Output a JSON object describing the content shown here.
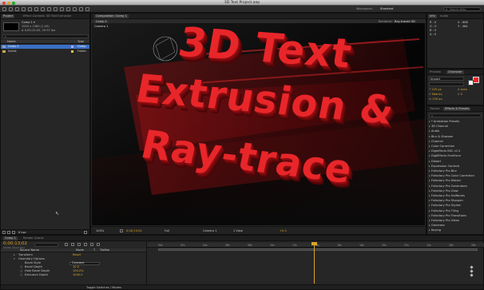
{
  "window": {
    "title": "3D Text Project.aep"
  },
  "toolbar": {
    "search_placeholder": "Search Help",
    "workspace": "Standard"
  },
  "project": {
    "tabs": [
      "Project",
      "Effect Controls: 3D Text Extrusion"
    ],
    "comp_name": "Comp 1 ▾",
    "comp_info": [
      "1920 x 1080 (1.00)",
      "Δ 0;00;10;00, 29.97 fps"
    ],
    "col_name": "Name",
    "col_type": "Type",
    "items": [
      {
        "name": "Comp 1",
        "type": "Comp"
      },
      {
        "name": "Solids",
        "type": "Folder"
      }
    ],
    "footer_bpc": "8 bpc"
  },
  "composition": {
    "tab": "Composition: Comp 1",
    "subtab": "Comp 1",
    "renderer_label": "Renderer:",
    "renderer_value": "Ray-traced 3D",
    "camera_label": "Camera 1",
    "text_lines": [
      "3D Text",
      "Extrusion &",
      "Ray-trace"
    ],
    "footer": {
      "zoom": "100%",
      "timecode": "0;00;13;02",
      "res": "Full",
      "camera": "Camera 1",
      "view": "1 View",
      "exposure": "+0.0"
    }
  },
  "info": {
    "tabs": [
      "Info",
      "Audio"
    ],
    "lines": [
      {
        "k": "R :",
        "v": "0"
      },
      {
        "k": "G :",
        "v": "0"
      },
      {
        "k": "B :",
        "v": "0"
      },
      {
        "k": "A :",
        "v": "0"
      }
    ],
    "x": "X : 668",
    "y": "Y : 464"
  },
  "character": {
    "tabs": [
      "Preview",
      "Character"
    ],
    "font": "Impact",
    "size": "225 px",
    "leading": "Auto",
    "kerning": "Metrics",
    "tracking": "0",
    "stroke": "150 px"
  },
  "effects": {
    "tabs": [
      "Tracker",
      "Effects & Presets"
    ],
    "items": [
      "* Animation Presets",
      "3D Channel",
      "Audio",
      "Blur & Sharpen",
      "Channel",
      "Color Correction",
      "Digieffects BSC v1.5",
      "DigiEffects FreeForm",
      "Distort",
      "Expression Controls",
      "Fxfactory Pro Blur",
      "Fxfactory Pro Color Correction",
      "Fxfactory Pro Distort",
      "Fxfactory Pro Generators",
      "Fxfactory Pro Glow",
      "Fxfactory Pro Halftones",
      "Fxfactory Pro Sharpen",
      "Fxfactory Pro Stylize",
      "Fxfactory Pro Tiling",
      "Fxfactory Pro Transitions",
      "Fxfactory Pro Video",
      "Generate",
      "Keying"
    ]
  },
  "timeline": {
    "tabs": [
      "Comp 1",
      "Render Queue"
    ],
    "timecode": "0;00;13;02",
    "sub_timecode": "00392 (29.97 fps)",
    "col_headers": [
      "Source Name",
      "Mode",
      "T",
      "TrkMat"
    ],
    "rows": [
      {
        "name": "Transform",
        "value": "Reset"
      },
      {
        "name": "Geometry Options",
        "value": ""
      },
      {
        "name": "Bevel Style",
        "value": "Concave"
      },
      {
        "name": "Bevel Depth",
        "value": "10.0"
      },
      {
        "name": "Hole Bevel Depth",
        "value": "100.0%"
      },
      {
        "name": "Extrusion Depth",
        "value": "1000.0"
      }
    ],
    "ruler": [
      "00s",
      "02s",
      "04s",
      "06s",
      "08s",
      "10s",
      "12s",
      "14s",
      "16s",
      "18s",
      "20s",
      "22s",
      "24s",
      "26s",
      "28s"
    ],
    "footer": "Toggle Switches / Modes"
  },
  "colors": {
    "accent_blue": "#3b6fc4",
    "text_red": "#e8262a",
    "current_time": "#d9a628"
  }
}
